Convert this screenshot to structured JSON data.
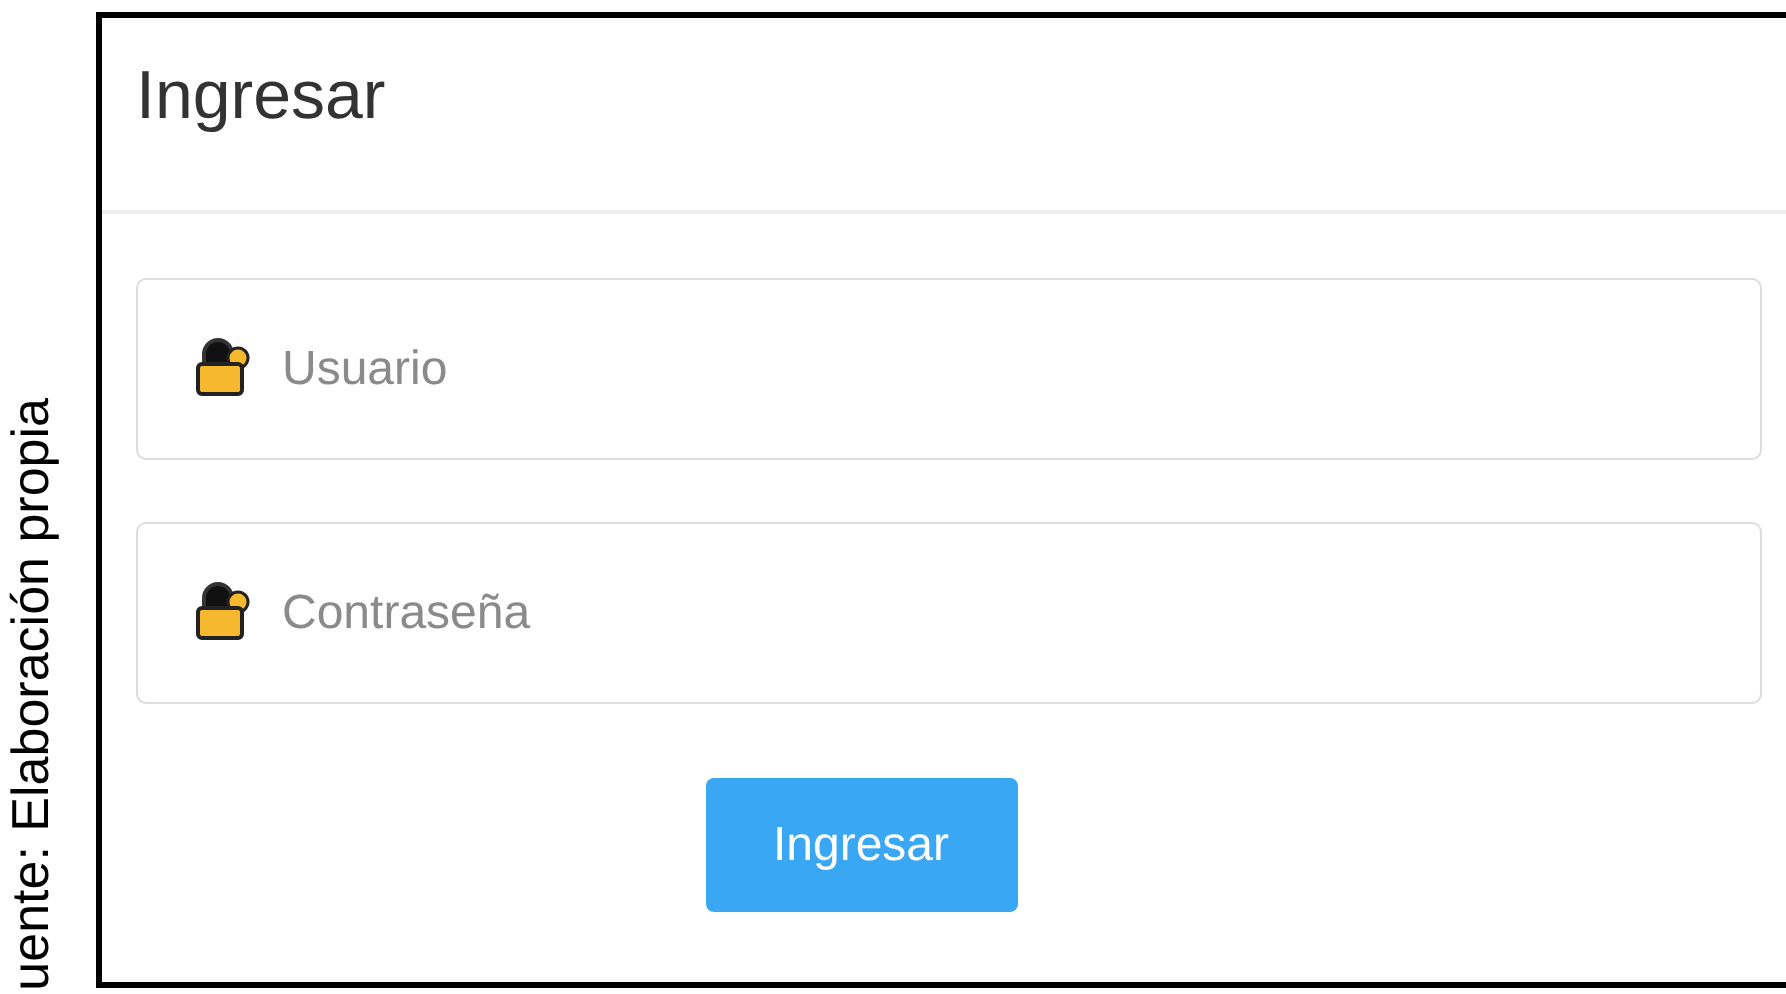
{
  "caption": "uente: Elaboración propia",
  "panel": {
    "title": "Ingresar"
  },
  "fields": [
    {
      "placeholder": "Usuario"
    },
    {
      "placeholder": "Contraseña"
    }
  ],
  "button": {
    "label": "Ingresar"
  }
}
